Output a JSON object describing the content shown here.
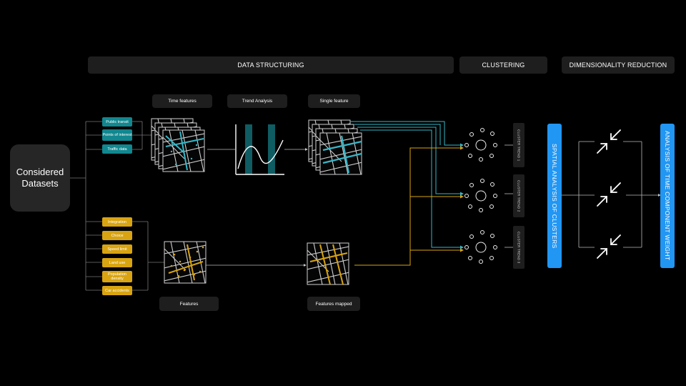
{
  "headers": {
    "data_structuring": "DATA STRUCTURING",
    "clustering": "CLUSTERING",
    "dimensionality_reduction": "DIMENSIONALITY REDUCTION"
  },
  "stage_labels": {
    "time_features": "Time features",
    "trend_analysis": "Trend Analysis",
    "single_feature": "Single feature",
    "features": "Features",
    "features_mapped": "Features mapped"
  },
  "datasets_title": "Considered\nDatasets",
  "time_datasets": [
    "Public transit",
    "Points of interest",
    "Traffic data"
  ],
  "static_datasets": [
    "Integration",
    "Choice",
    "Speed limit",
    "Land use",
    "Population density",
    "Car accidents"
  ],
  "clusters": [
    "CLUSTER TREND 1",
    "CLUSTER TREND 2",
    "CLUSTER TREND 3"
  ],
  "spatial_analysis": "SPATIAL ANALYSIS OF CLUSTERS",
  "time_component": "ANALYSIS OF TIME COMPONENT WEIGHT",
  "colors": {
    "teal": "#11878f",
    "yellow": "#d9a411",
    "cyan_line": "#35b7c8",
    "blue_bar": "#2196f3",
    "panel": "#1e1e1e"
  }
}
